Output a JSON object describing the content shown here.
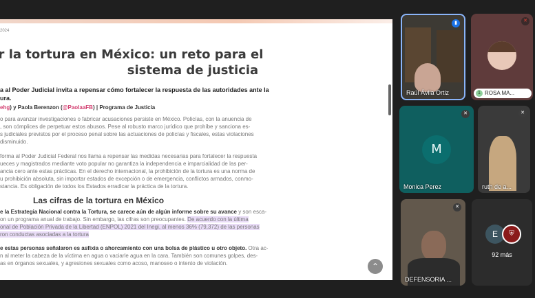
{
  "document": {
    "date": "2024",
    "title_line1": "r la tortura en México: un reto para el",
    "title_line2": "sistema de justicia",
    "subtitle": "a al Poder Judicial invita a repensar cómo fortalecer la respuesta de las autoridades ante la\nura.",
    "authors_handle1": "ehg",
    "authors_mid": ") y Paola Berenzon (",
    "authors_handle2": "@PaolaaFB",
    "authors_end": ") | Programa de Justicia",
    "para1": "o para avanzar investigaciones o fabricar acusaciones persiste en México. Policías, con la anuencia de\n, son cómplices de perpetuar estos abusos. Pese al robusto marco jurídico que prohíbe y sanciona es-\ns judiciales previstos por el proceso penal sobre las actuaciones de policías y fiscales, estas violaciones\n disminuido.",
    "para2": "forma al Poder Judicial Federal nos llama a repensar las medidas necesarias para fortalecer la respuesta\nueces y magistrados mediante voto popular no garantiza la independencia e imparcialidad de las per-\nancia cero ante estas prácticas. En el derecho internacional, la prohibición de la tortura es una norma de\nu prohibición absoluta, sin importar estados de excepción o de emergencia, conflictos armados, conmo-\nstancia. Es obligación de todos los Estados erradicar la práctica de la tortura.",
    "section_heading": "Las cifras de la tortura en México",
    "para3_a": "e la Estrategia Nacional contra la Tortura, se carece aún de algún informe sobre su avance",
    "para3_b": " y son esca-",
    "para3_c": "on un programa anual de trabajo. Sin embargo, las cifras son preocupantes. ",
    "para3_hl1": "De acuerdo con la última",
    "para3_hl2": "onal de Población Privada de la Libertad (ENPOL) 2021 del Inegi, al menos 36% (79,372) de las personas",
    "para3_hl3": "ron conductas asociadas a la tortura",
    "para4_a": "e estas personas señalaron es asfixia o ahorcamiento con una bolsa de plástico u otro objeto.",
    "para4_b": " Otra ac-",
    "para4_c": "n al meter la cabeza de la víctima en agua o vaciarle agua en la cara. También son comunes golpes, des-\nas en órganos sexuales, y agresiones sexuales como acoso, manoseo o intento de violación.",
    "scroll_up_glyph": "⌃"
  },
  "participants": [
    {
      "name": "Raúl Ávila Ortiz",
      "speaking": true
    },
    {
      "name": "ROSA MA...",
      "badge": "1"
    },
    {
      "name": "Monica Perez",
      "initial": "M"
    },
    {
      "name": "ruth de a..."
    },
    {
      "name": "DEFENSORIA ..."
    },
    {
      "name": "",
      "more_initial": "E",
      "more_label": "92 más"
    }
  ],
  "colors": {
    "background": "#1f1f1f",
    "teal_tile": "#0b6e6e",
    "avatar_teal": "#0b6e6e",
    "highlight": "#e9dcf7",
    "pink_link": "#d23d6f"
  }
}
